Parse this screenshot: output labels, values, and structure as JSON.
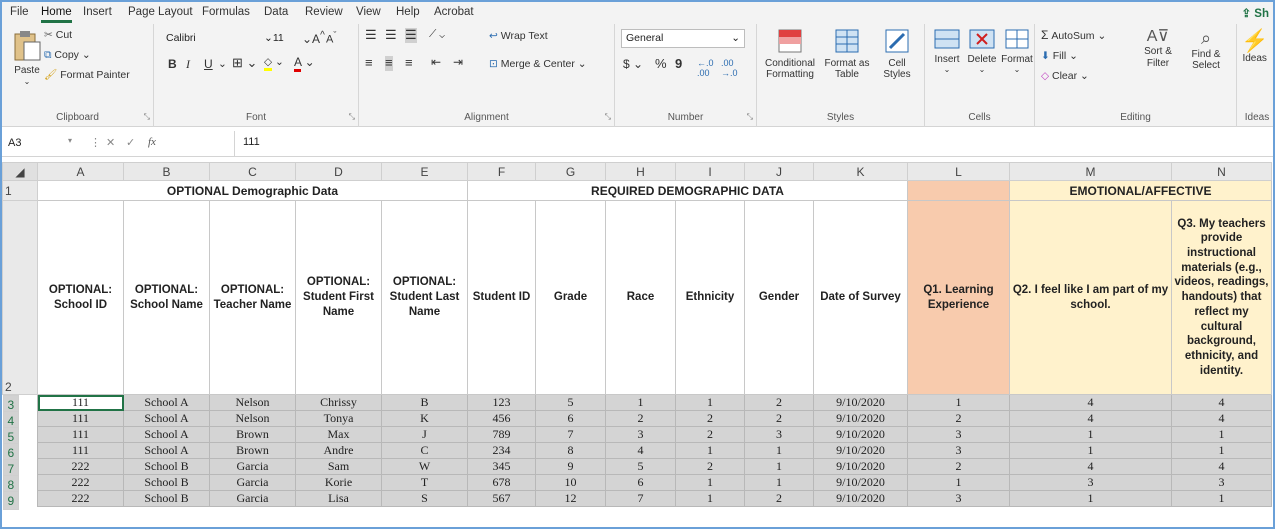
{
  "menu": {
    "tabs": [
      "File",
      "Home",
      "Insert",
      "Page Layout",
      "Formulas",
      "Data",
      "Review",
      "View",
      "Help",
      "Acrobat"
    ],
    "share": "Sh"
  },
  "ribbon": {
    "clipboard": {
      "paste": "Paste",
      "cut": "Cut",
      "copy": "Copy",
      "format_painter": "Format Painter",
      "label": "Clipboard"
    },
    "font": {
      "name": "Calibri",
      "size": "11",
      "bold": "B",
      "italic": "I",
      "underline": "U",
      "label": "Font"
    },
    "alignment": {
      "wrap": "Wrap Text",
      "merge": "Merge & Center",
      "label": "Alignment"
    },
    "number": {
      "format": "General",
      "currency": "$",
      "percent": "%",
      "comma": "9",
      "label": "Number"
    },
    "styles": {
      "conditional": "Conditional Formatting",
      "format_table": "Format as Table",
      "cell_styles": "Cell Styles",
      "label": "Styles"
    },
    "cells": {
      "insert": "Insert",
      "delete": "Delete",
      "format": "Format",
      "label": "Cells"
    },
    "editing": {
      "autosum": "AutoSum",
      "fill": "Fill",
      "clear": "Clear",
      "sort": "Sort & Filter",
      "find": "Find & Select",
      "label": "Editing"
    },
    "ideas": {
      "button": "Ideas",
      "label": "Ideas"
    }
  },
  "formula_bar": {
    "name_box": "A3",
    "value": "111",
    "fx": "fx"
  },
  "columns": [
    "A",
    "B",
    "C",
    "D",
    "E",
    "F",
    "G",
    "H",
    "I",
    "J",
    "K",
    "L",
    "M",
    "N"
  ],
  "row_numbers": [
    "1",
    "2",
    "3",
    "4",
    "5",
    "6",
    "7",
    "8",
    "9"
  ],
  "group_headers": {
    "optional": "OPTIONAL Demographic Data",
    "required": "REQUIRED DEMOGRAPHIC DATA",
    "emotional": "EMOTIONAL/AFFECTIVE"
  },
  "headers": [
    "OPTIONAL: School ID",
    "OPTIONAL: School Name",
    "OPTIONAL: Teacher Name",
    "OPTIONAL: Student First Name",
    "OPTIONAL: Student Last Name",
    "Student ID",
    "Grade",
    "Race",
    "Ethnicity",
    "Gender",
    "Date of Survey",
    "Q1. Learning Experience",
    "Q2. I feel like I am part of my school.",
    "Q3. My teachers provide instructional materials (e.g., videos, readings, handouts) that reflect my cultural background, ethnicity, and identity."
  ],
  "rows": [
    [
      "111",
      "School A",
      "Nelson",
      "Chrissy",
      "B",
      "123",
      "5",
      "1",
      "1",
      "2",
      "9/10/2020",
      "1",
      "4",
      "4"
    ],
    [
      "111",
      "School A",
      "Nelson",
      "Tonya",
      "K",
      "456",
      "6",
      "2",
      "2",
      "2",
      "9/10/2020",
      "2",
      "4",
      "4"
    ],
    [
      "111",
      "School A",
      "Brown",
      "Max",
      "J",
      "789",
      "7",
      "3",
      "2",
      "3",
      "9/10/2020",
      "3",
      "1",
      "1"
    ],
    [
      "111",
      "School A",
      "Brown",
      "Andre",
      "C",
      "234",
      "8",
      "4",
      "1",
      "1",
      "9/10/2020",
      "3",
      "1",
      "1"
    ],
    [
      "222",
      "School B",
      "Garcia",
      "Sam",
      "W",
      "345",
      "9",
      "5",
      "2",
      "1",
      "9/10/2020",
      "2",
      "4",
      "4"
    ],
    [
      "222",
      "School B",
      "Garcia",
      "Korie",
      "T",
      "678",
      "10",
      "6",
      "1",
      "1",
      "9/10/2020",
      "1",
      "3",
      "3"
    ],
    [
      "222",
      "School B",
      "Garcia",
      "Lisa",
      "S",
      "567",
      "12",
      "7",
      "1",
      "2",
      "9/10/2020",
      "3",
      "1",
      "1"
    ]
  ],
  "colors": {
    "accent": "#217346",
    "orange": "#f8cbad",
    "yellow": "#fff2cc"
  }
}
